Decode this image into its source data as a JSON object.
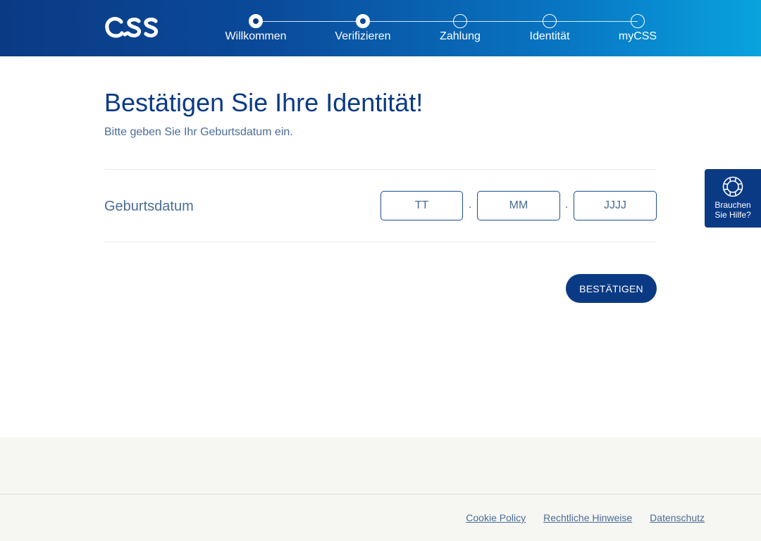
{
  "header": {
    "logo_text": "CSS",
    "steps": [
      {
        "label": "Willkommen",
        "state": "done"
      },
      {
        "label": "Verifizieren",
        "state": "done"
      },
      {
        "label": "Zahlung",
        "state": "pending"
      },
      {
        "label": "Identität",
        "state": "pending"
      },
      {
        "label": "myCSS",
        "state": "pending"
      }
    ]
  },
  "main": {
    "title": "Bestätigen Sie Ihre Identität!",
    "subtitle": "Bitte geben Sie Ihr Geburtsdatum ein.",
    "dob": {
      "label": "Geburtsdatum",
      "day_placeholder": "TT",
      "month_placeholder": "MM",
      "year_placeholder": "JJJJ",
      "separator": "."
    },
    "confirm_label": "BESTÄTIGEN"
  },
  "help": {
    "line1": "Brauchen",
    "line2": "Sie Hilfe?",
    "icon": "lifebuoy-icon"
  },
  "footer": {
    "links": [
      "Cookie Policy",
      "Rechtliche Hinweise",
      "Datenschutz"
    ]
  },
  "colors": {
    "brand_navy": "#0b3a84",
    "brand_cyan": "#09a3de",
    "text_muted": "#4a6c95",
    "footer_bg": "#f6f6f3"
  }
}
